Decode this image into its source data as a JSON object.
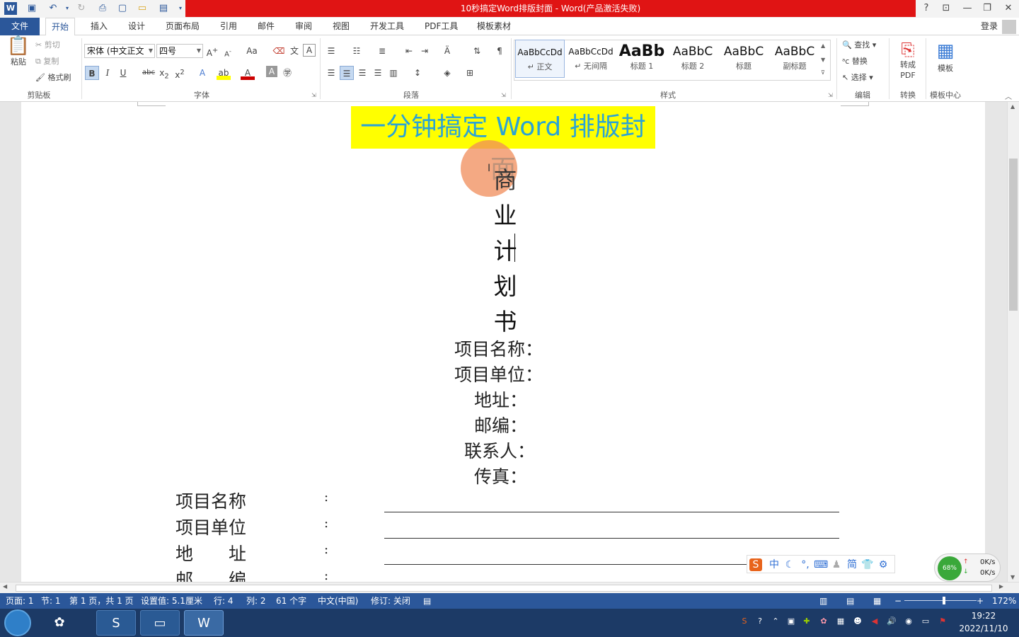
{
  "window": {
    "title": "10秒搞定Word排版封面 - Word(产品激活失败)",
    "help": "?"
  },
  "tabs": {
    "file": "文件",
    "items": [
      "开始",
      "插入",
      "设计",
      "页面布局",
      "引用",
      "邮件",
      "审阅",
      "视图",
      "开发工具",
      "PDF工具",
      "模板素材"
    ],
    "login": "登录"
  },
  "ribbon": {
    "clipboard": {
      "paste": "粘贴",
      "cut": "剪切",
      "copy": "复制",
      "format_painter": "格式刷",
      "label": "剪贴板"
    },
    "font": {
      "name": "宋体 (中文正文",
      "size": "四号",
      "label": "字体",
      "change_case": "Aa"
    },
    "paragraph": {
      "label": "段落"
    },
    "styles": {
      "label": "样式",
      "items": [
        {
          "sample": "AaBbCcDd",
          "name": "↵ 正文"
        },
        {
          "sample": "AaBbCcDd",
          "name": "↵ 无间隔"
        },
        {
          "sample": "AaBb",
          "name": "标题 1"
        },
        {
          "sample": "AaBbC",
          "name": "标题 2"
        },
        {
          "sample": "AaBbC",
          "name": "标题"
        },
        {
          "sample": "AaBbC",
          "name": "副标题"
        }
      ]
    },
    "edit": {
      "find": "查找",
      "replace": "替换",
      "select": "选择",
      "label": "编辑"
    },
    "convert": {
      "to_pdf": "转成\nPDF",
      "label": "转换"
    },
    "template": {
      "button": "模板",
      "label": "模板中心"
    }
  },
  "document": {
    "title": "一分钟搞定 Word 排版封面",
    "vertical_chars": [
      "商",
      "业",
      "计",
      "划",
      "书"
    ],
    "center_lines": [
      "项目名称：",
      "项目单位：",
      "地址：",
      "邮编：",
      "联系人：",
      "传真："
    ],
    "form_rows": [
      {
        "label": "项目名称",
        "colon": ":"
      },
      {
        "label": "项目单位",
        "colon": ":"
      },
      {
        "label": "地　　址",
        "colon": ":"
      },
      {
        "label": "邮　　编",
        "colon": ":"
      }
    ]
  },
  "ime": {
    "lang": "中",
    "simplified": "简"
  },
  "network": {
    "percent": "68%",
    "up": "0K/s",
    "down": "0K/s"
  },
  "statusbar": {
    "page": "页面: 1",
    "section": "节: 1",
    "page_of": "第 1 页，共 1 页",
    "position": "设置值: 5.1厘米",
    "row": "行: 4",
    "col": "列: 2",
    "words": "61 个字",
    "language": "中文(中国)",
    "track": "修订: 关闭",
    "zoom": "172%"
  },
  "taskbar": {
    "time": "19:22",
    "date": "2022/11/10"
  },
  "colors": {
    "accent": "#2b579a",
    "title_red": "#e01414",
    "highlight": "#ffff00",
    "title_text": "#2aa3d6"
  }
}
